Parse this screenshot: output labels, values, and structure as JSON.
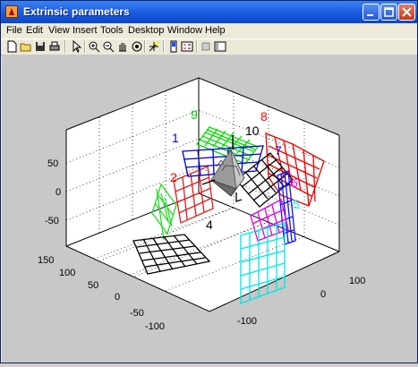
{
  "window": {
    "title": "Extrinsic parameters",
    "controls": [
      "minimize-icon",
      "maximize-icon",
      "close-icon"
    ]
  },
  "menu": [
    "File",
    "Edit",
    "View",
    "Insert",
    "Tools",
    "Desktop",
    "Window",
    "Help"
  ],
  "toolbar_icons": [
    "new-figure-icon",
    "open-file-icon",
    "save-icon",
    "print-icon",
    "select-arrow-icon",
    "zoom-in-icon",
    "zoom-out-icon",
    "pan-hand-icon",
    "rotate-3d-icon",
    "data-cursor-icon",
    "colorbar-icon",
    "legend-icon",
    "hide-plot-tools-icon",
    "show-plot-tools-icon"
  ],
  "plot": {
    "z_ticks": [
      "50",
      "0",
      "-50"
    ],
    "left_ticks": [
      "150",
      "100",
      "50",
      "0",
      "-50",
      "-100"
    ],
    "right_ticks": [
      "-100",
      "0",
      "100"
    ],
    "frame_labels": [
      {
        "text": "1",
        "color": "#0000ff"
      },
      {
        "text": "2",
        "color": "#ff0000"
      },
      {
        "text": "4",
        "color": "#000000"
      },
      {
        "text": "5",
        "color": "#00ffff"
      },
      {
        "text": "6",
        "color": "#ff00ff"
      },
      {
        "text": "7",
        "color": "#0000ff"
      },
      {
        "text": "8",
        "color": "#ff0000"
      },
      {
        "text": "9",
        "color": "#00cc00"
      },
      {
        "text": "10",
        "color": "#000000"
      }
    ]
  }
}
